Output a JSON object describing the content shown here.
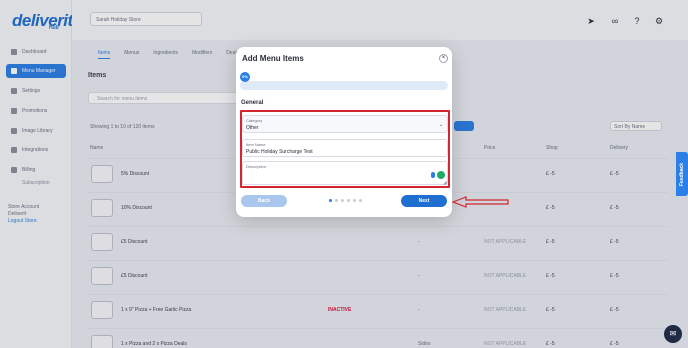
{
  "brand": {
    "logo": "deliverit",
    "sub": "Hub"
  },
  "sidebar": {
    "items": [
      {
        "label": "Dashboard"
      },
      {
        "label": "Menu Manager"
      },
      {
        "label": "Settings"
      },
      {
        "label": "Promotions"
      },
      {
        "label": "Image Library"
      },
      {
        "label": "Integrations"
      },
      {
        "label": "Billing"
      }
    ],
    "sub_item": "Subscription",
    "account_label": "Store Account",
    "account_name": "Deliverit",
    "account_link": "Logout Store"
  },
  "topbar": {
    "store_select": "Sarah Holiday Store"
  },
  "background": {
    "tabs": [
      "Items",
      "Menus",
      "Ingredients",
      "Modifiers",
      "Deals"
    ],
    "items_title": "Items",
    "search_placeholder": "Search for menu items",
    "showing": "Showing 1 to 10 of 120 items",
    "sort_label": "Sort By Name",
    "columns": [
      "Name",
      "Price",
      "Shop",
      "Delivery"
    ],
    "rows": [
      {
        "name": "5% Discount",
        "tag": "",
        "dash": "",
        "muted": "",
        "v1": "£ -5",
        "v2": "£ -5"
      },
      {
        "name": "10% Discount",
        "tag": "",
        "dash": "",
        "muted": "",
        "v1": "£ -5",
        "v2": "£ -5"
      },
      {
        "name": "£5 Discount",
        "tag": "",
        "dash": "-",
        "muted": "NOT APPLICABLE",
        "v1": "£ -5",
        "v2": "£ -5"
      },
      {
        "name": "£5 Discount",
        "tag": "",
        "dash": "-",
        "muted": "NOT APPLICABLE",
        "v1": "£ -5",
        "v2": "£ -5"
      },
      {
        "name": "1 x 9\" Pizza + Free Garlic Pizza",
        "tag": "INACTIVE",
        "dash": "-",
        "muted": "NOT APPLICABLE",
        "v1": "£ -5",
        "v2": "£ -5"
      },
      {
        "name": "1 x Pizza and 2 x Pizza Deals",
        "tag": "",
        "dash": "Sides",
        "muted": "NOT APPLICABLE",
        "v1": "£ -5",
        "v2": "£ -5"
      }
    ]
  },
  "modal": {
    "title": "Add Menu Items",
    "close": "×",
    "progress_badge": "0%",
    "progress_fraction": 0.0,
    "section": "General",
    "category_label": "Category",
    "category_value": "Other",
    "item_name_label": "Item Name",
    "item_name_value": "Public Holiday Surcharge Test",
    "description_label": "Description",
    "description_value": "",
    "back_label": "Back",
    "next_label": "Next",
    "steps_total": 6,
    "steps_current": 1
  },
  "feedback_label": "Feedback",
  "colors": {
    "accent": "#2b7fe6",
    "highlight": "#d22630",
    "next": "#1f6fd1"
  }
}
